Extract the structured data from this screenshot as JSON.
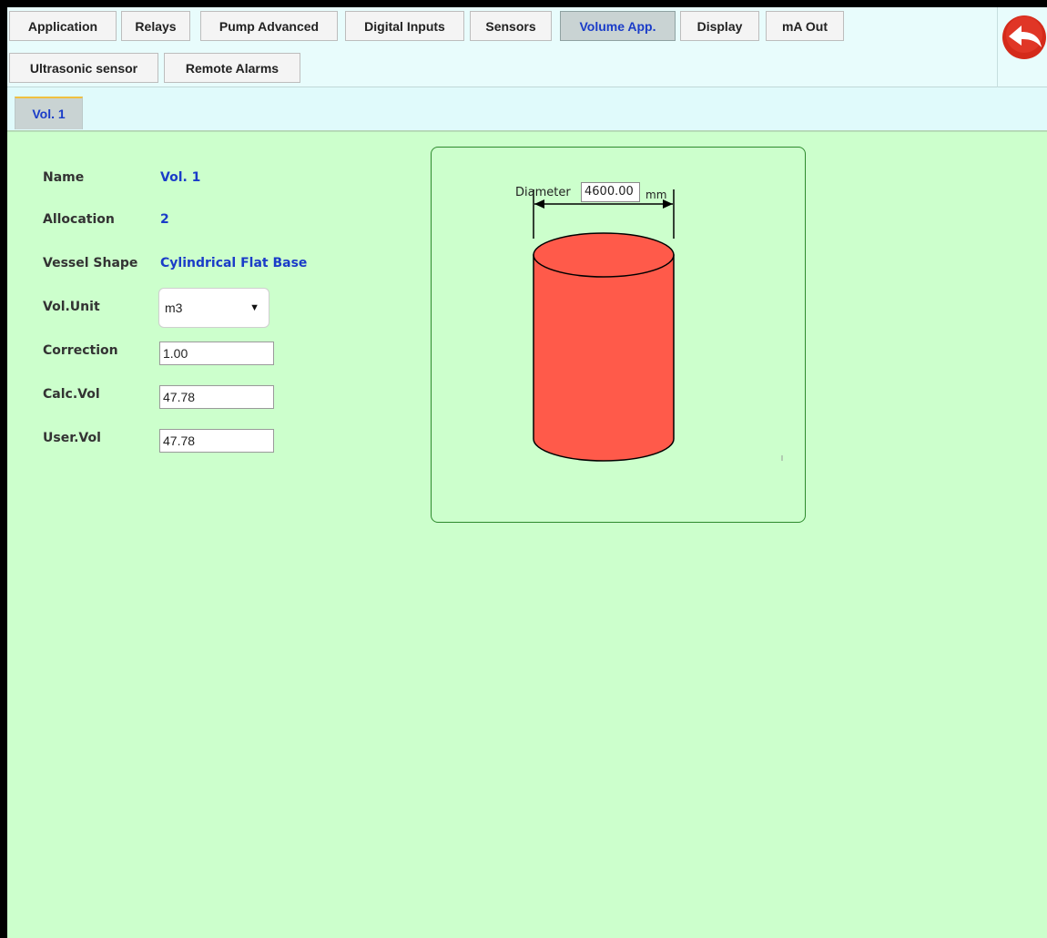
{
  "tabs": {
    "row1": [
      {
        "label": "Application",
        "active": false
      },
      {
        "label": "Relays",
        "active": false
      },
      {
        "label": "Pump Advanced",
        "active": false
      },
      {
        "label": "Digital Inputs",
        "active": false
      },
      {
        "label": "Sensors",
        "active": false
      },
      {
        "label": "Volume App.",
        "active": true
      },
      {
        "label": "Display",
        "active": false
      },
      {
        "label": "mA Out",
        "active": false
      }
    ],
    "row2": [
      {
        "label": "Ultrasonic sensor",
        "active": false
      },
      {
        "label": "Remote Alarms",
        "active": false
      }
    ]
  },
  "back_button": {
    "icon": "back-arrow-icon",
    "color": "#d42a1a"
  },
  "subtabs": [
    {
      "label": "Vol. 1",
      "active": true
    }
  ],
  "form": {
    "name": {
      "label": "Name",
      "value": "Vol. 1"
    },
    "allocation": {
      "label": "Allocation",
      "value": "2"
    },
    "vessel_shape": {
      "label": "Vessel Shape",
      "value": "Cylindrical Flat Base"
    },
    "vol_unit": {
      "label": "Vol.Unit",
      "selected": "m3"
    },
    "correction": {
      "label": "Correction",
      "value": "1.00"
    },
    "calc_vol": {
      "label": "Calc.Vol",
      "value": "47.78"
    },
    "user_vol": {
      "label": "User.Vol",
      "value": "47.78"
    }
  },
  "vessel": {
    "diameter_label": "Diameter",
    "diameter_value": "4600.00",
    "diameter_unit": "mm",
    "fill_color": "#ff5a4a"
  },
  "colors": {
    "panel_bg": "#ccffcc",
    "tab_bar_bg": "#e8fcfc",
    "accent_text": "#1a3cc8"
  }
}
